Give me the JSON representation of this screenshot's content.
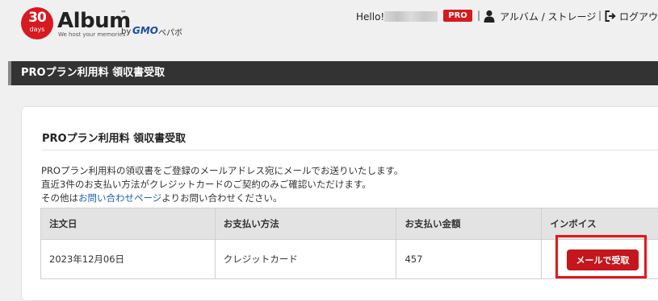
{
  "header": {
    "logo": {
      "badge_number": "30",
      "badge_sub": "days",
      "wordmark": "Album",
      "tm": "™",
      "by": "by",
      "gmo": "GMO",
      "pepabo": "ペパボ",
      "tagline": "We host your memories"
    },
    "hello": "Hello!",
    "pro_badge": "PRO",
    "separator": "|",
    "album_storage_label": "アルバム / ストレージ",
    "logout_label": "ログアウ"
  },
  "title_bar": {
    "text": "PROプラン利用料 領収書受取"
  },
  "panel": {
    "title": "PROプラン利用料 領収書受取",
    "desc_line1": "PROプラン利用料の領収書をご登録のメールアドレス宛にメールでお送りいたします。",
    "desc_line2": "直近3件のお支払い方法がクレジットカードのご契約のみご確認いただけます。",
    "desc_line3_prefix": "その他は",
    "desc_line3_link": "お問い合わせページ",
    "desc_line3_suffix": "よりお問い合わせください。"
  },
  "table": {
    "headers": [
      "注文日",
      "お支払い方法",
      "お支払い金額",
      "インボイス"
    ],
    "rows": [
      {
        "date": "2023年12月06日",
        "method": "クレジットカード",
        "amount": "457",
        "button": "メールで受取"
      }
    ]
  },
  "colors": {
    "brand_red": "#d71920",
    "title_bar": "#333333",
    "link": "#1f5fa8",
    "highlight": "#e8141a"
  }
}
